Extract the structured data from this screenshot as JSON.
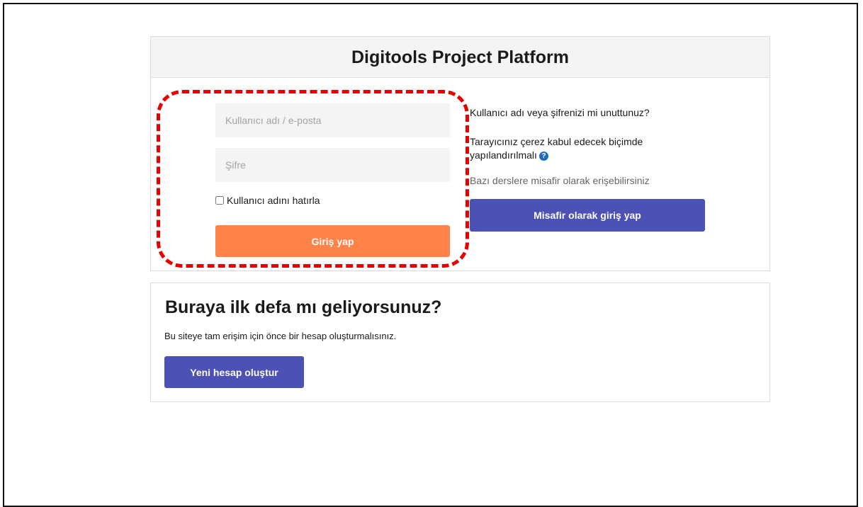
{
  "login": {
    "title": "Digitools Project Platform",
    "username_placeholder": "Kullanıcı adı / e-posta",
    "password_placeholder": "Şifre",
    "remember_label": "Kullanıcı adını hatırla",
    "remember_checked": false,
    "login_button": "Giriş yap",
    "forgot_link": "Kullanıcı adı veya şifrenizi mi unuttunuz?",
    "cookie_notice": "Tarayıcınız çerez kabul edecek biçimde yapılandırılmalı",
    "help_icon": "question-circle-icon",
    "guest_notice": "Bazı derslere misafir olarak erişebilirsiniz",
    "guest_button": "Misafir olarak giriş yap"
  },
  "signup": {
    "title": "Buraya ilk defa mı geliyorsunuz?",
    "description": "Bu siteye tam erişim için önce bir hesap oluşturmalısınız.",
    "button": "Yeni hesap oluştur"
  },
  "colors": {
    "login_button": "#ff8349",
    "primary_button": "#4b51b5",
    "annotation": "#e60000",
    "help_icon": "#1f6fb8"
  }
}
